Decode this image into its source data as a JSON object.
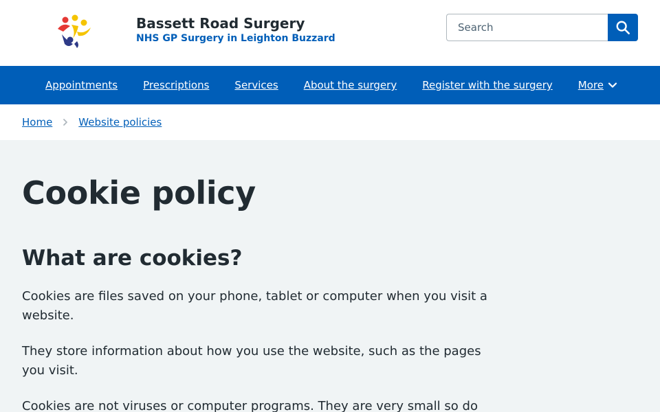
{
  "header": {
    "site_name": "Bassett Road Surgery",
    "site_subtitle": "NHS GP Surgery in Leighton Buzzard",
    "logo_icon": "people-logo-icon",
    "search": {
      "placeholder": "Search",
      "button_icon": "search-icon"
    }
  },
  "nav": {
    "items": [
      {
        "label": "Appointments"
      },
      {
        "label": "Prescriptions"
      },
      {
        "label": "Services"
      },
      {
        "label": "About the surgery"
      },
      {
        "label": "Register with the surgery"
      },
      {
        "label": "More",
        "icon": "chevron-down-icon"
      }
    ]
  },
  "breadcrumb": {
    "items": [
      {
        "label": "Home"
      },
      {
        "label": "Website policies"
      }
    ],
    "separator_icon": "chevron-right-icon"
  },
  "main": {
    "title": "Cookie policy",
    "section_title": "What are cookies?",
    "paragraphs": [
      "Cookies are files saved on your phone, tablet or computer when you visit a website.",
      "They store information about how you use the website, such as the pages you visit.",
      "Cookies are not viruses or computer programs. They are very small so do"
    ]
  },
  "colors": {
    "nhs_blue": "#005eb8",
    "text": "#212b32",
    "page_background": "#f0f4f5"
  }
}
